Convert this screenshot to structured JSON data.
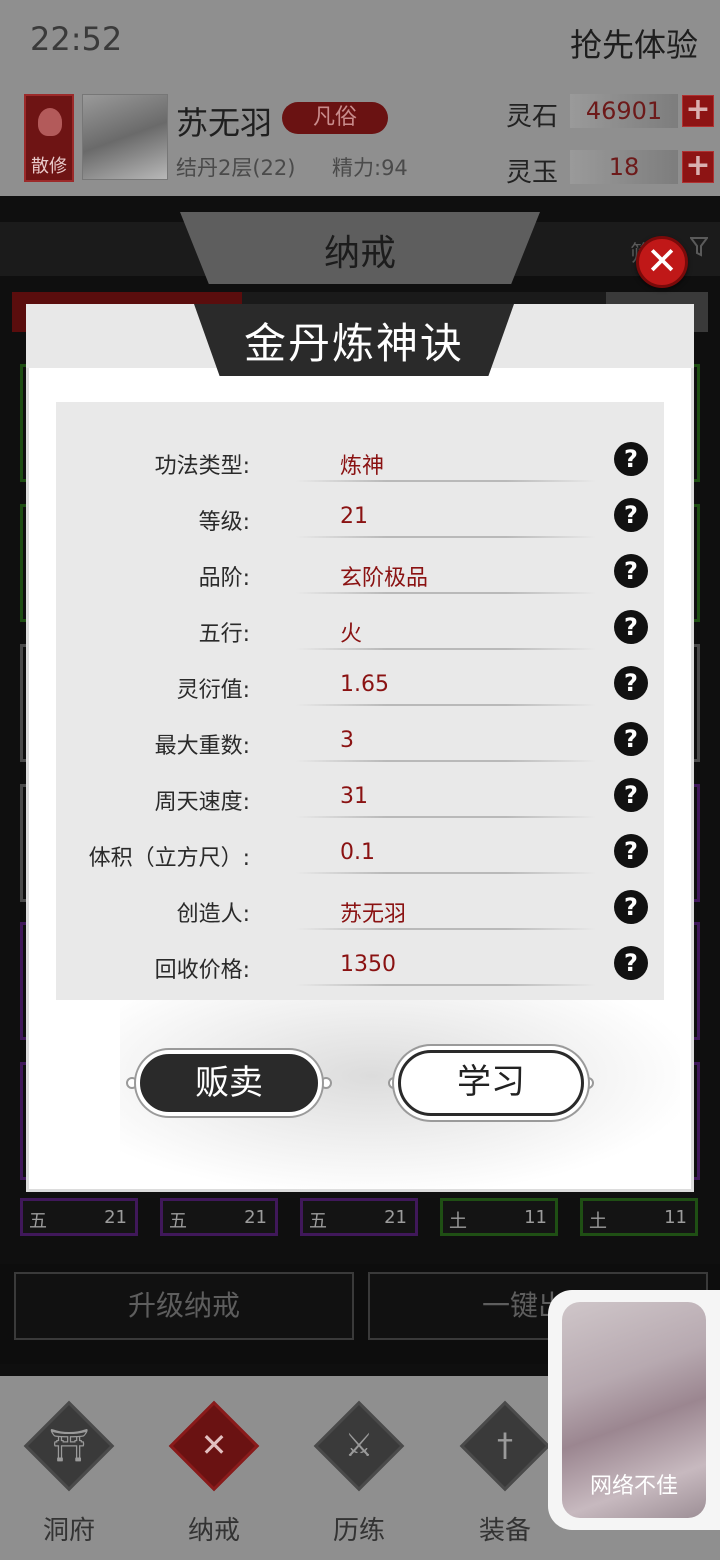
{
  "status_bar": {
    "time": "22:52",
    "trial_label": "抢先体验"
  },
  "player": {
    "sect_badge": "散修",
    "name": "苏无羽",
    "rank_tag": "凡俗",
    "realm": "结丹2层(22)",
    "energy": "精力:94"
  },
  "currencies": [
    {
      "label": "灵石",
      "value": "46901",
      "add": "+"
    },
    {
      "label": "灵玉",
      "value": "18",
      "add": "+"
    }
  ],
  "ring": {
    "title": "纳戒",
    "filter_label": "筛",
    "filter_icon": "funnel-icon"
  },
  "slots_bottom": [
    {
      "element": "五",
      "level": "21",
      "color": "purple"
    },
    {
      "element": "五",
      "level": "21",
      "color": "purple"
    },
    {
      "element": "五",
      "level": "21",
      "color": "purple"
    },
    {
      "element": "土",
      "level": "11",
      "color": "green"
    },
    {
      "element": "土",
      "level": "11",
      "color": "green"
    }
  ],
  "actions_bottom": {
    "upgrade": "升级纳戒",
    "oneclick": "一键出"
  },
  "nav": [
    {
      "label": "洞府",
      "icon": "cave-gate-icon",
      "glyph": "⛩"
    },
    {
      "label": "纳戒",
      "icon": "close-x-icon",
      "glyph": "✕"
    },
    {
      "label": "历练",
      "icon": "crossed-swords-icon",
      "glyph": "⚔"
    },
    {
      "label": "装备",
      "icon": "dagger-icon",
      "glyph": "†"
    }
  ],
  "modal": {
    "title": "金丹炼神诀",
    "close": "✕",
    "properties": [
      {
        "label": "功法类型:",
        "value": "炼神"
      },
      {
        "label": "等级:",
        "value": "21"
      },
      {
        "label": "品阶:",
        "value": "玄阶极品"
      },
      {
        "label": "五行:",
        "value": "火"
      },
      {
        "label": "灵衍值:",
        "value": "1.65"
      },
      {
        "label": "最大重数:",
        "value": "3"
      },
      {
        "label": "周天速度:",
        "value": "31"
      },
      {
        "label": "体积（立方尺）:",
        "value": "0.1"
      },
      {
        "label": "创造人:",
        "value": "苏无羽"
      },
      {
        "label": "回收价格:",
        "value": "1350"
      }
    ],
    "help_glyph": "?",
    "sell_label": "贩卖",
    "learn_label": "学习"
  },
  "float_video": {
    "status": "网络不佳"
  },
  "colors": {
    "accent_red": "#8a1212",
    "close_red": "#c01818",
    "dark": "#2a2a2a"
  }
}
